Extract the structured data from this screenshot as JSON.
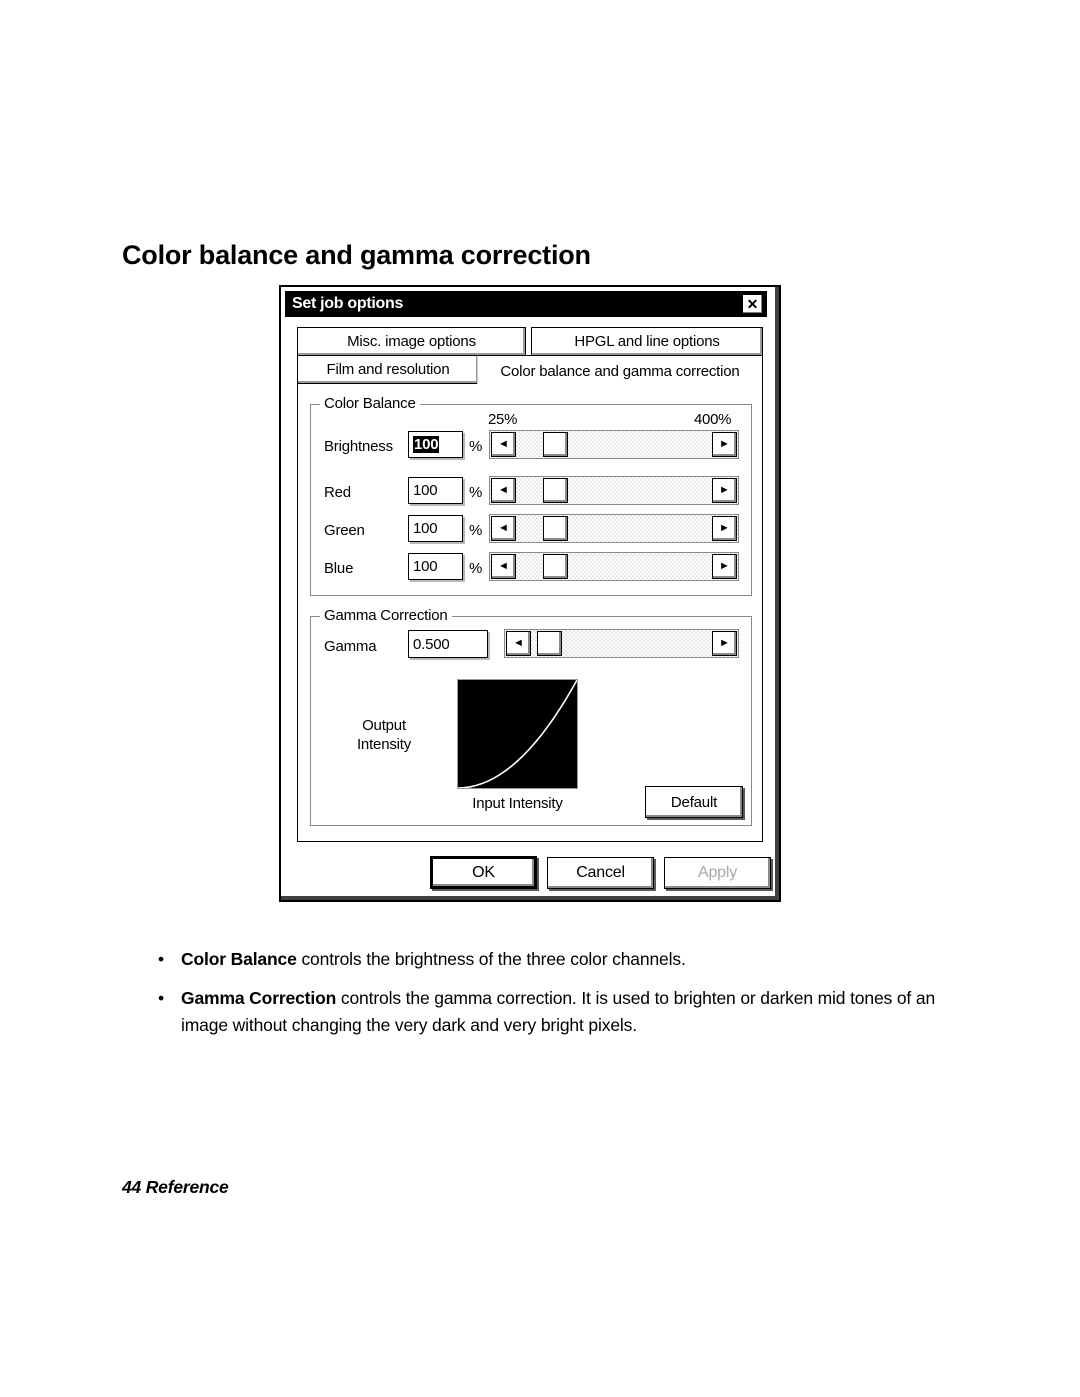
{
  "page": {
    "title": "Color balance and gamma correction",
    "footer": "44 Reference"
  },
  "dialog": {
    "titlebar": {
      "title": "Set job options",
      "close_icon": "close-icon",
      "close_glyph": "✕"
    },
    "tabs": [
      {
        "label": "Misc. image options",
        "active": false
      },
      {
        "label": "HPGL and line options",
        "active": false
      },
      {
        "label": "Film and resolution",
        "active": false
      },
      {
        "label": "Color balance and gamma correction",
        "active": true
      }
    ],
    "color_balance": {
      "legend": "Color Balance",
      "range_min_label": "25%",
      "range_max_label": "400%",
      "unit": "%",
      "rows": [
        {
          "label": "Brightness",
          "value": "100",
          "selected": true
        },
        {
          "label": "Red",
          "value": "100",
          "selected": false
        },
        {
          "label": "Green",
          "value": "100",
          "selected": false
        },
        {
          "label": "Blue",
          "value": "100",
          "selected": false
        }
      ]
    },
    "gamma_correction": {
      "legend": "Gamma Correction",
      "row_label": "Gamma",
      "value": "0.500",
      "y_axis_label": "Output\nIntensity",
      "y_axis_line1": "Output",
      "y_axis_line2": "Intensity",
      "x_axis_label": "Input Intensity",
      "default_button": "Default"
    },
    "buttons": {
      "ok": "OK",
      "cancel": "Cancel",
      "apply": "Apply"
    },
    "arrows": {
      "left_glyph": "◄",
      "right_glyph": "►"
    }
  },
  "notes": [
    {
      "bold": "Color Balance",
      "text": " controls the brightness of the three color channels."
    },
    {
      "bold": "Gamma Correction",
      "text": " controls the gamma correction. It is used to brighten or darken mid tones of an image without changing the very dark and very bright pixels."
    }
  ],
  "chart_data": {
    "type": "line",
    "title": "",
    "xlabel": "Input Intensity",
    "ylabel": "Output Intensity",
    "xlim": [
      0,
      1
    ],
    "ylim": [
      0,
      1
    ],
    "grid": false,
    "legend": "none",
    "series": [
      {
        "name": "gamma 0.500",
        "gamma": 0.5,
        "x": [
          0.0,
          0.05,
          0.1,
          0.15,
          0.2,
          0.25,
          0.3,
          0.35,
          0.4,
          0.45,
          0.5,
          0.55,
          0.6,
          0.65,
          0.7,
          0.75,
          0.8,
          0.85,
          0.9,
          0.95,
          1.0
        ],
        "y": [
          0.0,
          0.003,
          0.01,
          0.023,
          0.04,
          0.063,
          0.09,
          0.123,
          0.16,
          0.203,
          0.25,
          0.303,
          0.36,
          0.423,
          0.49,
          0.563,
          0.64,
          0.723,
          0.81,
          0.903,
          1.0
        ]
      }
    ]
  }
}
